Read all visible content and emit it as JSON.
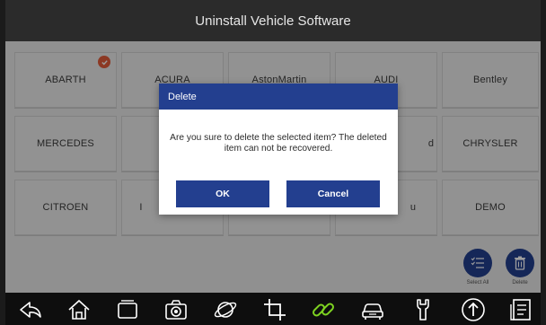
{
  "header": {
    "title": "Uninstall Vehicle Software"
  },
  "vehicles": [
    {
      "name": "ABARTH",
      "selected": true
    },
    {
      "name": "ACURA"
    },
    {
      "name": "AstonMartin"
    },
    {
      "name": "AUDI"
    },
    {
      "name": "Bentley"
    },
    {
      "name": "MERCEDES"
    },
    {
      "name": ""
    },
    {
      "name": ""
    },
    {
      "name": "d"
    },
    {
      "name": "CHRYSLER"
    },
    {
      "name": "CITROEN"
    },
    {
      "name": "I"
    },
    {
      "name": ""
    },
    {
      "name": "u"
    },
    {
      "name": "DEMO"
    }
  ],
  "actions": {
    "select_all": "Select All",
    "delete": "Delete"
  },
  "dialog": {
    "title": "Delete",
    "message": "Are you sure to delete the selected item? The deleted item can not be recovered.",
    "ok": "OK",
    "cancel": "Cancel"
  },
  "colors": {
    "accent": "#233f8f",
    "check": "#e25d3b",
    "link_icon": "#7ed321"
  },
  "bottom_nav": [
    "back-icon",
    "home-icon",
    "recent-apps-icon",
    "camera-icon",
    "browser-icon",
    "crop-icon",
    "link-icon",
    "car-icon",
    "wrench-icon",
    "upload-icon",
    "document-icon"
  ]
}
